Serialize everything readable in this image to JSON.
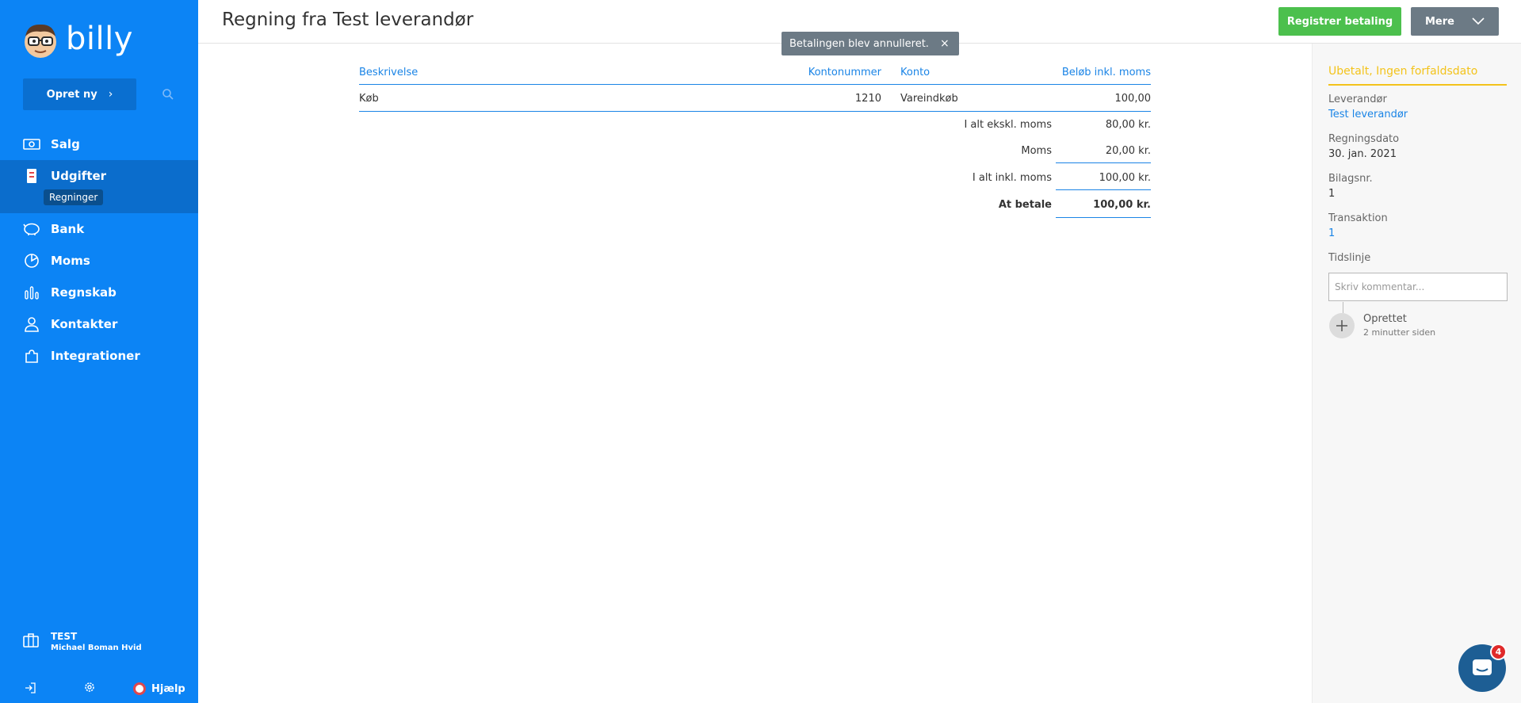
{
  "sidebar": {
    "logo_text": "billy",
    "create_label": "Opret ny",
    "nav": [
      {
        "label": "Salg",
        "icon": "cash-icon"
      },
      {
        "label": "Udgifter",
        "icon": "receipt-icon",
        "sub": "Regninger"
      },
      {
        "label": "Bank",
        "icon": "piggy-bank-icon"
      },
      {
        "label": "Moms",
        "icon": "pie-chart-icon"
      },
      {
        "label": "Regnskab",
        "icon": "bar-chart-icon"
      },
      {
        "label": "Kontakter",
        "icon": "person-icon"
      },
      {
        "label": "Integrationer",
        "icon": "puzzle-icon"
      }
    ],
    "org_name": "TEST",
    "org_user": "Michael Boman Hvid",
    "help_label": "Hjælp"
  },
  "header": {
    "title": "Regning fra Test leverandør",
    "register_label": "Registrer betaling",
    "more_label": "Mere"
  },
  "toast": {
    "message": "Betalingen blev annulleret.",
    "close": "×"
  },
  "bill": {
    "headers": {
      "description": "Beskrivelse",
      "account_no": "Kontonummer",
      "account": "Konto",
      "amount": "Beløb inkl. moms"
    },
    "lines": [
      {
        "description": "Køb",
        "account_no": "1210",
        "account": "Vareindkøb",
        "amount": "100,00"
      }
    ],
    "totals": [
      {
        "label": "I alt ekskl. moms",
        "value": "80,00 kr."
      },
      {
        "label": "Moms",
        "value": "20,00 kr."
      },
      {
        "label": "I alt inkl. moms",
        "value": "100,00 kr."
      },
      {
        "label": "At betale",
        "value": "100,00 kr."
      }
    ]
  },
  "details": {
    "status": "Ubetalt, Ingen forfaldsdato",
    "supplier_label": "Leverandør",
    "supplier": "Test leverandør",
    "date_label": "Regningsdato",
    "date": "30. jan. 2021",
    "voucher_label": "Bilagsnr.",
    "voucher": "1",
    "transaction_label": "Transaktion",
    "transaction": "1",
    "timeline_label": "Tidslinje",
    "comment_placeholder": "Skriv kommentar...",
    "timeline_event": "Oprettet",
    "timeline_time": "2 minutter siden"
  },
  "chat": {
    "badge": "4"
  },
  "colors": {
    "sidebar": "#0c84f5",
    "accent": "#1a84e6",
    "green": "#4cc04d",
    "status": "#f3c31b"
  }
}
